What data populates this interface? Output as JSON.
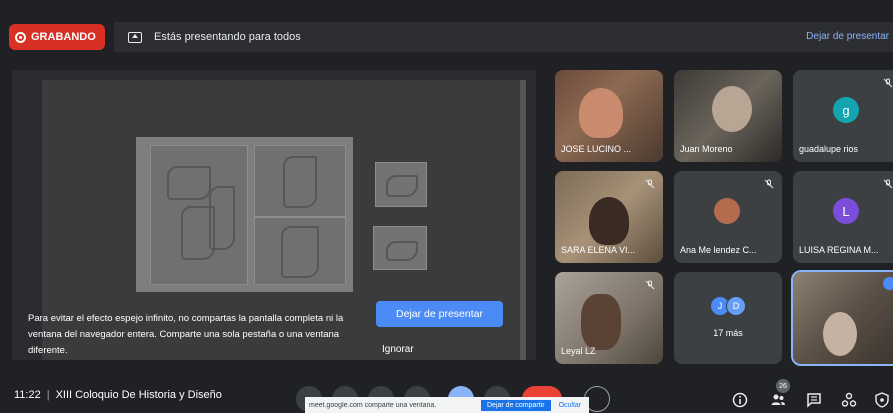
{
  "topbar": {
    "recording_label": "GRABANDO",
    "presenting_text": "Estás presentando para todos",
    "stop_presenting_link": "Dejar de presentar"
  },
  "screen_share": {
    "warning_text": "Para evitar el efecto espejo infinito, no compartas la pantalla completa ni la ventana del navegador entera. Comparte una sola pestaña o una ventana diferente.",
    "stop_button": "Dejar de presentar",
    "ignore_button": "Ignorar"
  },
  "participants": [
    {
      "name": "JOSE LUCINO ...",
      "muted": false
    },
    {
      "name": "Juan Moreno",
      "muted": false
    },
    {
      "name": "guadalupe rios",
      "muted": true,
      "initial": "g",
      "color": "#12a4af"
    },
    {
      "name": "SARA ELENA VI...",
      "muted": true
    },
    {
      "name": "Ana Me lendez C...",
      "muted": true
    },
    {
      "name": "LUISA REGINA M...",
      "muted": true,
      "initial": "L",
      "color": "#7b4ddb"
    },
    {
      "name": "Leyal LZ",
      "muted": true
    },
    {
      "name": "",
      "muted": false
    }
  ],
  "more": {
    "label": "17 más",
    "avatars": [
      "J",
      "D"
    ],
    "colors": [
      "#4c8bf5",
      "#669df6"
    ]
  },
  "bottombar": {
    "time": "11:22",
    "meeting_title": "XIII Coloquio De Historia y Diseño",
    "participant_count": "26"
  },
  "share_notice": {
    "text": "meet.google.com comparte una ventana.",
    "stop": "Dejar de compartir",
    "hide": "Ocultar"
  },
  "colors": {
    "accent": "#8ab4f8",
    "record": "#d93025",
    "button": "#4c8bf5"
  }
}
